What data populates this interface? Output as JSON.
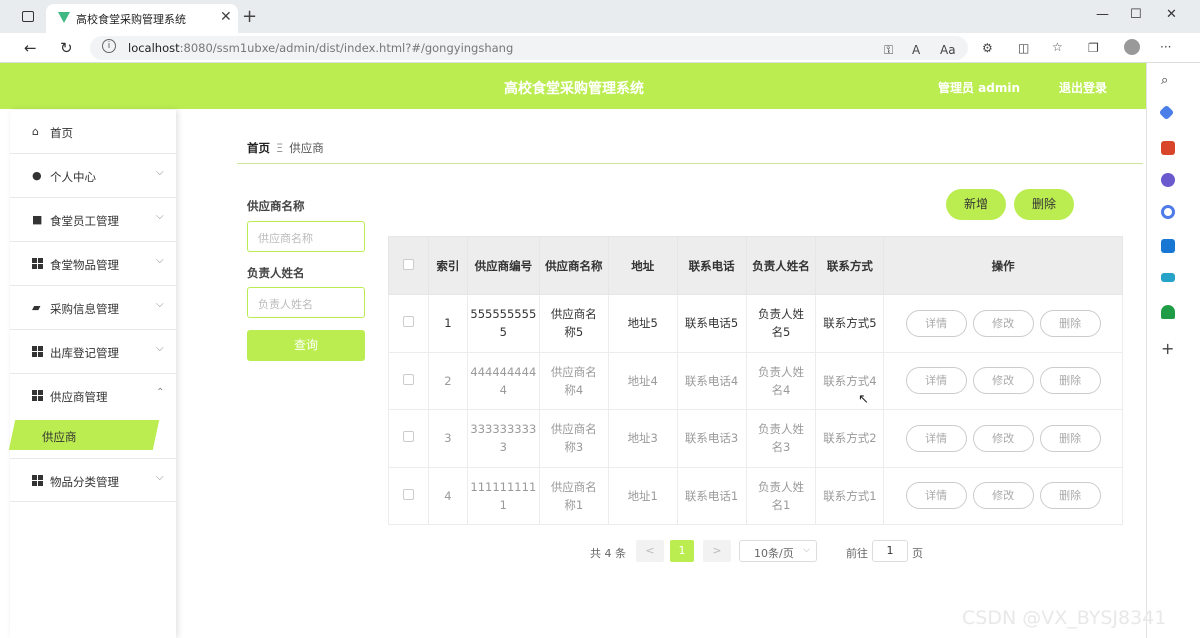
{
  "browser": {
    "tab_title": "高校食堂采购管理系统",
    "url_host": "localhost",
    "url_rest": ":8080/ssm1ubxe/admin/dist/index.html?#/gongyingshang"
  },
  "header": {
    "title": "高校食堂采购管理系统",
    "admin": "管理员 admin",
    "logout": "退出登录"
  },
  "sidebar": {
    "items": [
      {
        "label": "首页",
        "icon": "home-icon"
      },
      {
        "label": "个人中心",
        "icon": "user-icon"
      },
      {
        "label": "食堂员工管理",
        "icon": "briefcase-icon"
      },
      {
        "label": "食堂物品管理",
        "icon": "grid-icon"
      },
      {
        "label": "采购信息管理",
        "icon": "cart-icon"
      },
      {
        "label": "出库登记管理",
        "icon": "grid-icon"
      },
      {
        "label": "供应商管理",
        "icon": "grid-icon"
      },
      {
        "label": "物品分类管理",
        "icon": "grid-icon"
      }
    ],
    "active_sub": "供应商"
  },
  "breadcrumb": {
    "home": "首页",
    "sep": "Ξ",
    "current": "供应商"
  },
  "filters": {
    "name_label": "供应商名称",
    "name_placeholder": "供应商名称",
    "person_label": "负责人姓名",
    "person_placeholder": "负责人姓名",
    "query": "查询"
  },
  "actions": {
    "add": "新增",
    "delete": "删除"
  },
  "table": {
    "headers": [
      "索引",
      "供应商编号",
      "供应商名称",
      "地址",
      "联系电话",
      "负责人姓名",
      "联系方式",
      "操作"
    ],
    "rows": [
      {
        "idx": "1",
        "code": "5555555555",
        "name": "供应商名称5",
        "addr": "地址5",
        "phone": "联系电话5",
        "person": "负责人姓名5",
        "contact": "联系方式5"
      },
      {
        "idx": "2",
        "code": "4444444444",
        "name": "供应商名称4",
        "addr": "地址4",
        "phone": "联系电话4",
        "person": "负责人姓名4",
        "contact": "联系方式4"
      },
      {
        "idx": "3",
        "code": "3333333333",
        "name": "供应商名称3",
        "addr": "地址3",
        "phone": "联系电话3",
        "person": "负责人姓名3",
        "contact": "联系方式2"
      },
      {
        "idx": "4",
        "code": "1111111111",
        "name": "供应商名称1",
        "addr": "地址1",
        "phone": "联系电话1",
        "person": "负责人姓名1",
        "contact": "联系方式1"
      }
    ],
    "ops": {
      "detail": "详情",
      "edit": "修改",
      "delete": "删除"
    }
  },
  "pagination": {
    "total": "共 4 条",
    "prev": "<",
    "page": "1",
    "next": ">",
    "size": "10条/页",
    "goto": "前往",
    "goto_value": "1",
    "page_unit": "页"
  },
  "watermark": "CSDN @VX_BYSJ8341",
  "colors": {
    "accent": "#bbed51"
  }
}
